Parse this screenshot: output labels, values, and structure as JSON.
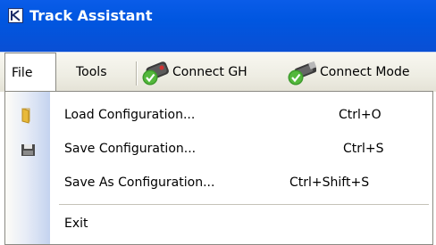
{
  "window": {
    "title": "Track Assistant",
    "titlebar_color": "#0055e3",
    "app_icon": "app-logo-icon"
  },
  "menubar": {
    "file_label": "File",
    "tools_label": "Tools",
    "toolbar_buttons": [
      {
        "label": "Connect GH",
        "icon": "device-connect-icon"
      },
      {
        "label": "Connect Mode",
        "icon": "usb-connect-icon"
      }
    ]
  },
  "file_menu": {
    "items": [
      {
        "label": "Load Configuration...",
        "shortcut": "Ctrl+O",
        "icon": "folder-icon"
      },
      {
        "label": "Save Configuration...",
        "shortcut": "Ctrl+S",
        "icon": "floppy-disk-icon"
      },
      {
        "label": "Save As Configuration...",
        "shortcut": "Ctrl+Shift+S",
        "icon": ""
      },
      {
        "label": "Exit",
        "shortcut": "",
        "icon": ""
      }
    ]
  }
}
